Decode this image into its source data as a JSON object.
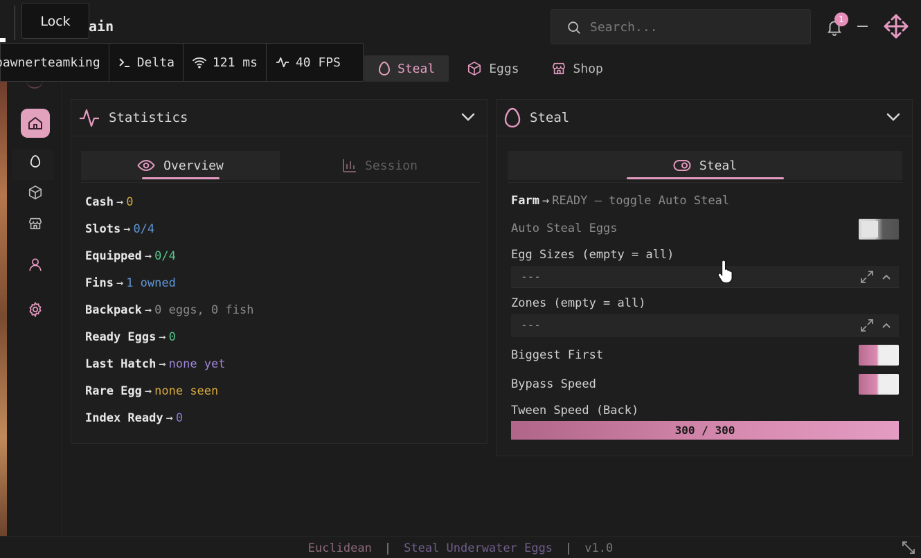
{
  "window": {
    "title": "Main",
    "title_visible": "ain",
    "search_placeholder": "Search...",
    "notification_count": "1"
  },
  "tooltip": {
    "label": "Lock"
  },
  "infobar": {
    "user": "pawnerteamking",
    "executor": "Delta",
    "ping": "121 ms",
    "fps": "40 FPS"
  },
  "top_tabs": [
    {
      "label": "Steal",
      "icon": "egg-icon",
      "active": true
    },
    {
      "label": "Eggs",
      "icon": "cube-icon",
      "active": false
    },
    {
      "label": "Shop",
      "icon": "store-icon",
      "active": false
    }
  ],
  "sidebar": {
    "items": [
      {
        "icon": "home-icon",
        "active": true
      },
      {
        "icon": "egg-icon",
        "active": false
      },
      {
        "icon": "cube-icon",
        "active": false
      },
      {
        "icon": "store-icon",
        "active": false
      },
      {
        "icon": "user-icon",
        "active": false
      },
      {
        "icon": "gear-icon",
        "active": false
      }
    ]
  },
  "statistics": {
    "title": "Statistics",
    "tabs": [
      {
        "label": "Overview",
        "active": true
      },
      {
        "label": "Session",
        "active": false
      }
    ],
    "rows": [
      {
        "key": "Cash",
        "value": "0",
        "color": "#d8a93e"
      },
      {
        "key": "Slots",
        "value": "0/4",
        "color": "#5f97d6"
      },
      {
        "key": "Equipped",
        "value": "0/4",
        "color": "#55c48a"
      },
      {
        "key": "Fins",
        "value": "1 owned",
        "color": "#5f97d6"
      },
      {
        "key": "Backpack",
        "value": "0 eggs, 0 fish",
        "color": "#8a8a8a"
      },
      {
        "key": "Ready Eggs",
        "value": "0",
        "color": "#55c48a"
      },
      {
        "key": "Last Hatch",
        "value": "none yet",
        "color": "#9d86d9"
      },
      {
        "key": "Rare Egg",
        "value": "none seen",
        "color": "#d8a93e"
      },
      {
        "key": "Index Ready",
        "value": "0",
        "color": "#8a7ad6"
      }
    ]
  },
  "steal": {
    "title": "Steal",
    "tab": "Steal",
    "farm_key": "Farm",
    "farm_status": "READY — toggle Auto Steal",
    "auto_steal_label": "Auto Steal Eggs",
    "auto_steal": false,
    "egg_sizes_label": "Egg Sizes (empty = all)",
    "egg_sizes_value": "---",
    "zones_label": "Zones (empty = all)",
    "zones_value": "---",
    "biggest_first_label": "Biggest First",
    "biggest_first": true,
    "bypass_speed_label": "Bypass Speed",
    "bypass_speed": true,
    "tween_label": "Tween Speed (Back)",
    "tween_value": 300,
    "tween_max": 300,
    "tween_text": "300 / 300"
  },
  "footer": {
    "author": "Euclidean",
    "game": "Steal Underwater Eggs",
    "version": "v1.0",
    "separator": "|"
  },
  "colors": {
    "accent": "#e49ac0",
    "background": "#1c1c1c",
    "panel": "#1e1e1e"
  }
}
